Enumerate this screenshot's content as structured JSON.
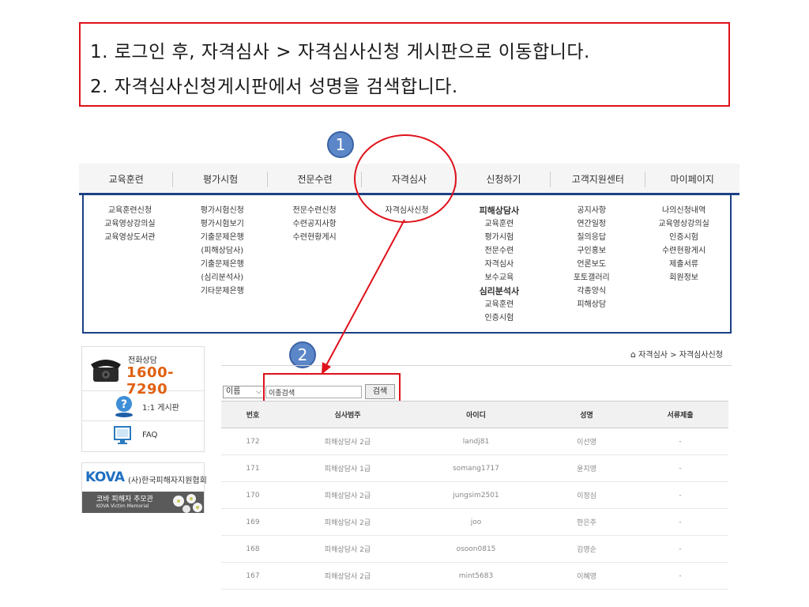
{
  "instructions": [
    "1.  로그인 후, 자격심사 > 자격심사신청 게시판으로 이동합니다.",
    "2.  자격심사신청게시판에서 성명을 검색합니다."
  ],
  "markers": [
    "1",
    "2"
  ],
  "nav": [
    "교육훈련",
    "평가시험",
    "전문수련",
    "자격심사",
    "신청하기",
    "고객지원센터",
    "마이페이지"
  ],
  "menu": [
    [
      "교육훈련신청",
      "교육영상강의실",
      "교육영상도서관"
    ],
    [
      "평가시험신청",
      "평가시험보기",
      "기출문제은행",
      "(피해상담사)",
      "기출문제은행",
      "(심리분석사)",
      "기타문제은행"
    ],
    [
      "전문수련신청",
      "수련공지사항",
      "수련현황게시"
    ],
    [
      "자격심사신청"
    ],
    [
      "피해상담사",
      "교육훈련",
      "평가시험",
      "전문수련",
      "자격심사",
      "보수교육",
      "심리분석사",
      "교육훈련",
      "인증시험"
    ],
    [
      "공지사항",
      "연간일정",
      "질의응답",
      "구인홍보",
      "언론보도",
      "포토갤러리",
      "각종양식",
      "피해상담"
    ],
    [
      "나의신청내역",
      "교육영상강의실",
      "인증시험",
      "수련현황게시",
      "제출서류",
      "회원정보"
    ]
  ],
  "sidebar": {
    "phone_label": "전화상담",
    "phone_number": "1600-7290",
    "board_label": "1:1 게시판",
    "faq_label": "FAQ"
  },
  "kova": {
    "logo": "KOVA",
    "name": "(사)한국피해자지원협회",
    "memorial": "코바 피해자 추모관",
    "memorial_en": "KOVA Victim Memorial"
  },
  "breadcrumb": "자격심사 > 자격심사신청",
  "search": {
    "select_value": "이름",
    "input_value": "이종검색",
    "button_label": "검색"
  },
  "table": {
    "headers": [
      "번호",
      "심사범주",
      "아이디",
      "성명",
      "서류제출"
    ],
    "rows": [
      [
        "172",
        "피해상담사 2급",
        "landj81",
        "이선영",
        "-"
      ],
      [
        "171",
        "피해상담사 1급",
        "somang1717",
        "윤지영",
        "-"
      ],
      [
        "170",
        "피해상담사 2급",
        "jungsim2501",
        "이정심",
        "-"
      ],
      [
        "169",
        "피해상담사 2급",
        "joo",
        "한은주",
        "-"
      ],
      [
        "168",
        "피해상담사 2급",
        "osoon0815",
        "김영순",
        "-"
      ],
      [
        "167",
        "피해상담사 2급",
        "mint5683",
        "이혜영",
        "-"
      ]
    ]
  },
  "colors": {
    "highlight": "#e0111b",
    "nav_border": "#1c3f86",
    "marker": "#5b86c8",
    "phone": "#e06010"
  }
}
